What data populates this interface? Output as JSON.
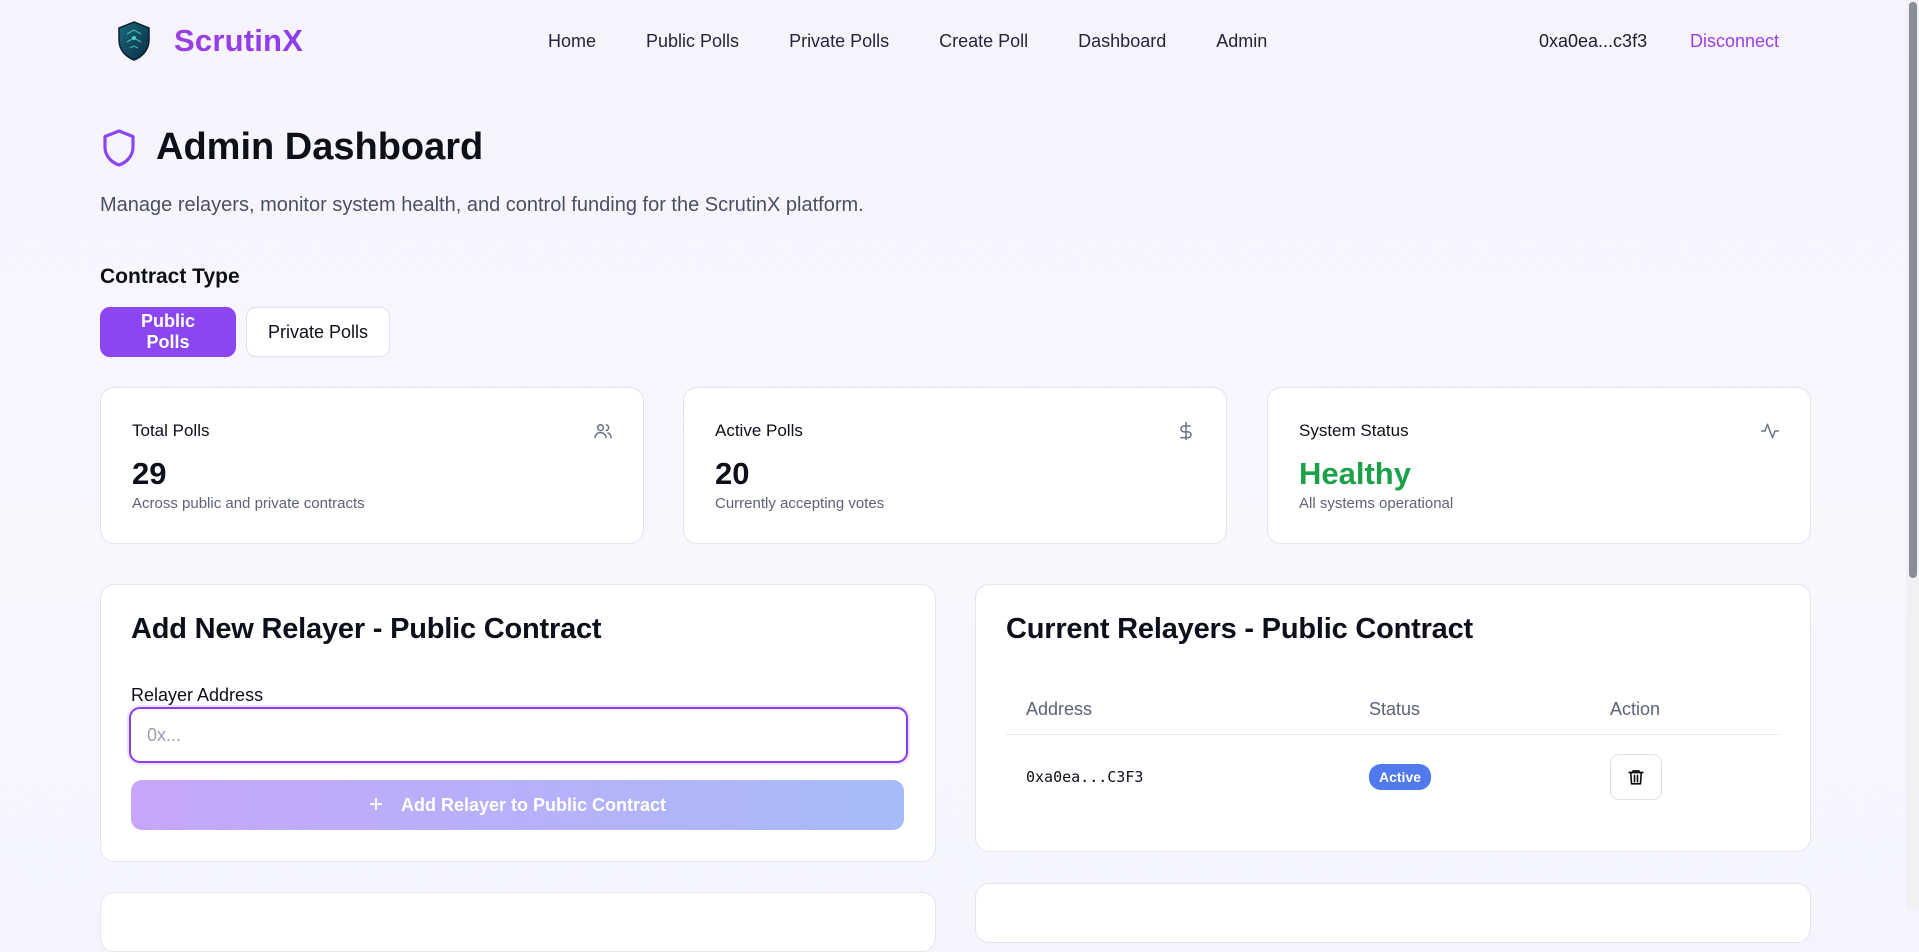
{
  "brand": {
    "name": "ScrutinX"
  },
  "nav": {
    "items": [
      {
        "label": "Home"
      },
      {
        "label": "Public Polls"
      },
      {
        "label": "Private Polls"
      },
      {
        "label": "Create Poll"
      },
      {
        "label": "Dashboard"
      },
      {
        "label": "Admin"
      }
    ],
    "wallet_address": "0xa0ea...c3f3",
    "disconnect_label": "Disconnect"
  },
  "header": {
    "title": "Admin Dashboard",
    "subtitle": "Manage relayers, monitor system health, and control funding for the ScrutinX platform.",
    "icon": "shield-icon"
  },
  "contract_type": {
    "label": "Contract Type",
    "options": [
      {
        "label": "Public Polls",
        "selected": true
      },
      {
        "label": "Private Polls",
        "selected": false
      }
    ]
  },
  "stats": [
    {
      "title": "Total Polls",
      "value": "29",
      "subtitle": "Across public and private contracts",
      "icon": "users-icon"
    },
    {
      "title": "Active Polls",
      "value": "20",
      "subtitle": "Currently accepting votes",
      "icon": "dollar-icon"
    },
    {
      "title": "System Status",
      "value": "Healthy",
      "subtitle": "All systems operational",
      "icon": "activity-icon",
      "value_color": "#1ca14a"
    }
  ],
  "add_relayer": {
    "title": "Add New Relayer - Public Contract",
    "field_label": "Relayer Address",
    "input_value": "",
    "input_placeholder": "0x...",
    "button_label": "Add Relayer to Public Contract"
  },
  "relayers": {
    "title": "Current Relayers - Public Contract",
    "columns": [
      "Address",
      "Status",
      "Action"
    ],
    "rows": [
      {
        "address": "0xa0ea...C3F3",
        "status": "Active"
      }
    ]
  },
  "colors": {
    "accent": "#8b46f2",
    "brand": "#9b3fe2",
    "status_active": "#4f79ec",
    "healthy": "#1ca14a"
  }
}
